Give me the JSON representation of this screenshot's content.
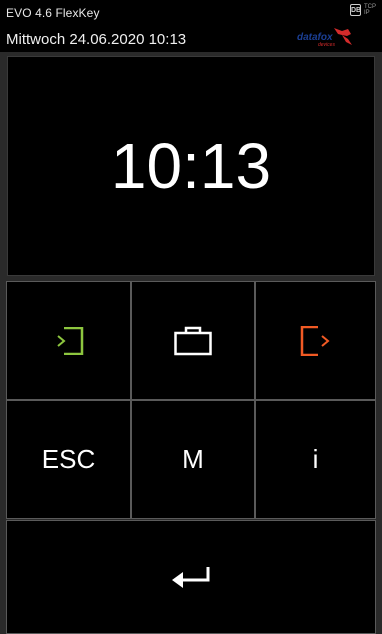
{
  "header": {
    "device_name": "EVO 4.6 FlexKey",
    "datetime": "Mittwoch 24.06.2020 10:13",
    "db_label": "DB",
    "net_label_1": "TCP",
    "net_label_2": "IP",
    "logo_text": "datafox",
    "logo_sub": "devices"
  },
  "clock": {
    "time": "10:13"
  },
  "keys": {
    "login": {
      "icon": "login-arrow-icon",
      "color": "#8dc63f"
    },
    "business": {
      "icon": "briefcase-icon",
      "color": "#ffffff"
    },
    "logout": {
      "icon": "logout-arrow-icon",
      "color": "#f15a24"
    },
    "esc_label": "ESC",
    "menu_label": "M",
    "info_label": "i",
    "enter": {
      "icon": "enter-arrow-icon"
    }
  },
  "colors": {
    "background": "#000000",
    "border": "#5a5a5a",
    "logo_blue": "#1b3f94",
    "logo_red": "#d42b2b"
  }
}
